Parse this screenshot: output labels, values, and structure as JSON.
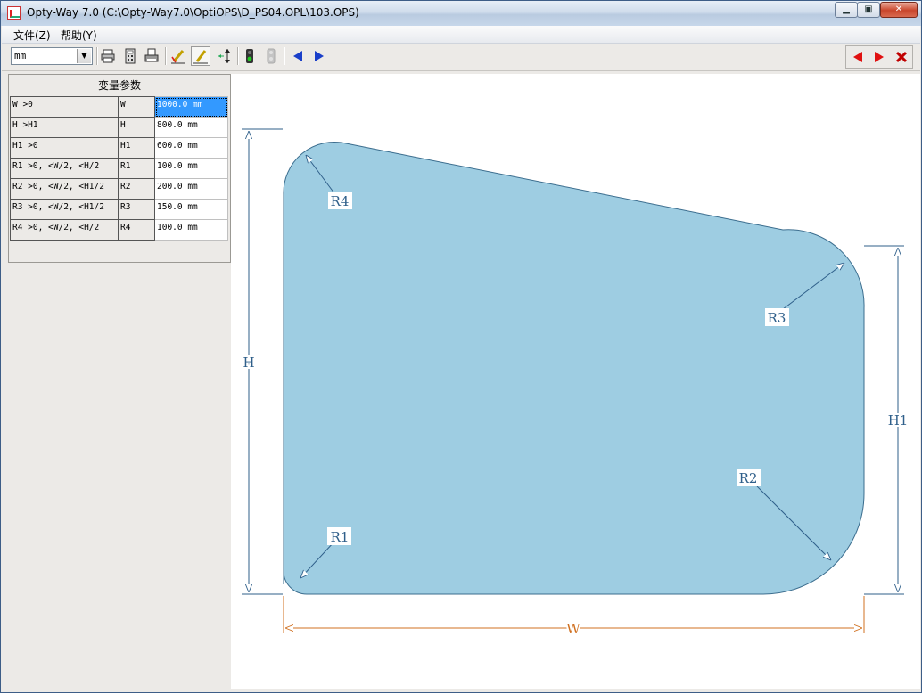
{
  "window": {
    "title": "Opty-Way 7.0 (C:\\Opty-Way7.0\\OptiOPS\\D_PS04.OPL\\103.OPS)"
  },
  "menu": [
    "文件(Z)",
    "帮助(Y)"
  ],
  "toolbar": {
    "unit_value": "mm"
  },
  "panel": {
    "title": "变量参数",
    "rows": [
      {
        "constraint": "W >0",
        "name": "W",
        "value": "1000.0 mm"
      },
      {
        "constraint": "H >H1",
        "name": "H",
        "value": "800.0 mm"
      },
      {
        "constraint": "H1 >0",
        "name": "H1",
        "value": "600.0 mm"
      },
      {
        "constraint": "R1 >0, <W/2, <H/2",
        "name": "R1",
        "value": "100.0 mm"
      },
      {
        "constraint": "R2 >0, <W/2, <H1/2",
        "name": "R2",
        "value": "200.0 mm"
      },
      {
        "constraint": "R3 >0, <W/2, <H1/2",
        "name": "R3",
        "value": "150.0 mm"
      },
      {
        "constraint": "R4 >0, <W/2, <H/2",
        "name": "R4",
        "value": "100.0 mm"
      }
    ]
  },
  "drawing": {
    "shape_fill": "#9ecde2",
    "dim_color": "#2f5f8a",
    "width_dim_color": "#d07020",
    "labels": {
      "w": "W",
      "h": "H",
      "h1": "H1",
      "r1": "R1",
      "r2": "R2",
      "r3": "R3",
      "r4": "R4"
    }
  },
  "icons": {
    "app": "app-icon",
    "print": "print-icon",
    "calculator": "calculator-icon",
    "printer2": "printer-icon",
    "edit1": "pencil-check-icon",
    "edit2": "pencil-icon",
    "dimension": "dimension-arrows-icon",
    "traffic_on": "traffic-light-icon",
    "traffic_off": "traffic-light-disabled-icon",
    "prev_blue": "arrow-left-icon",
    "next_blue": "arrow-right-icon",
    "prev_red": "arrow-left-red-icon",
    "next_red": "arrow-right-red-icon",
    "close_red": "close-red-icon"
  }
}
